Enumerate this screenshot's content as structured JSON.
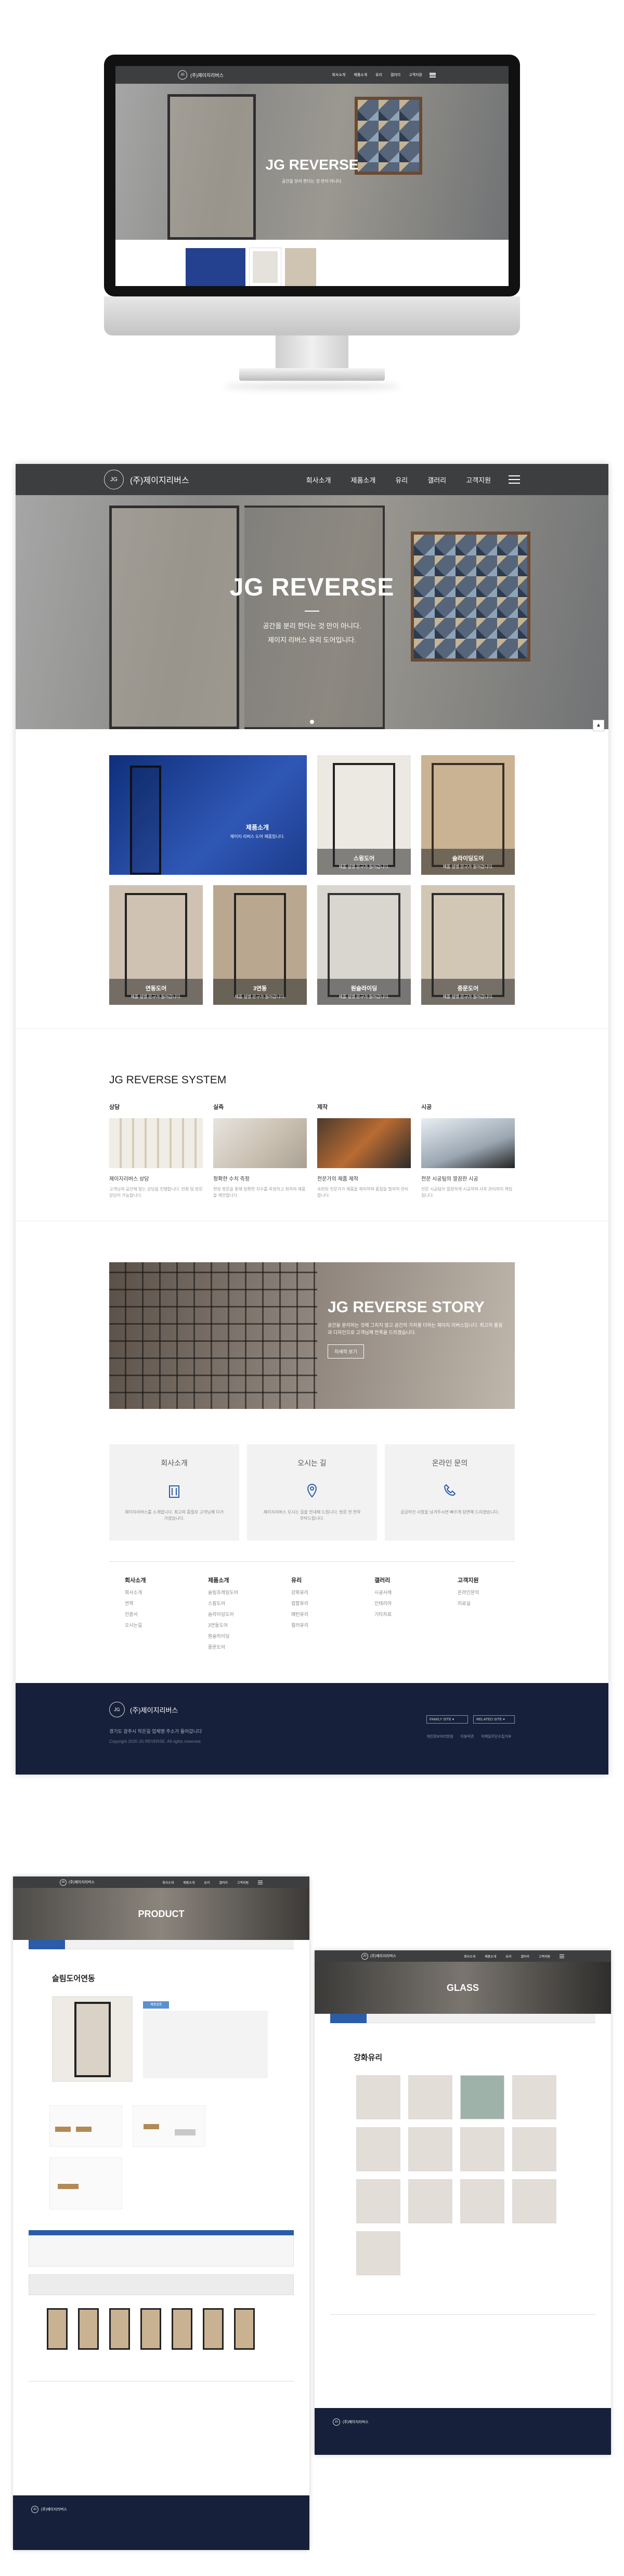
{
  "brand": {
    "name": "(주)제이지리버스"
  },
  "nav": [
    "회사소개",
    "제품소개",
    "유리",
    "갤러리",
    "고객지원"
  ],
  "hero": {
    "title": "JG REVERSE",
    "line1": "공간을 분리 한다는 것 만이 아니다.",
    "line2": "제이지 리버스 유리 도어입니다."
  },
  "products": [
    {
      "title": "제품소개",
      "sub": "제이지 리버스 도어 제품입니다."
    },
    {
      "title": "스윙도어",
      "sub": "제품 설명 문구가 들어갑니다."
    },
    {
      "title": "슬라이딩도어",
      "sub": "제품 설명 문구가 들어갑니다."
    },
    {
      "title": "연동도어",
      "sub": "제품 설명 문구가 들어갑니다."
    },
    {
      "title": "3연동",
      "sub": "제품 설명 문구가 들어갑니다."
    },
    {
      "title": "원슬라이딩",
      "sub": "제품 설명 문구가 들어갑니다."
    },
    {
      "title": "중문도어",
      "sub": "제품 설명 문구가 들어갑니다."
    }
  ],
  "system": {
    "title": "JG REVERSE SYSTEM",
    "items": [
      {
        "label": "상담",
        "heading": "제이지리버스 상담",
        "text": "고객님의 공간에 맞는 상담을 진행합니다. 전화 및 방문 상담이 가능합니다."
      },
      {
        "label": "실측",
        "heading": "정확한 수치 측정",
        "text": "현장 방문을 통해 정확한 치수를 측정하고 최적의 제품을 제안합니다."
      },
      {
        "label": "제작",
        "heading": "전문가의 제품 제작",
        "text": "숙련된 전문가가 제품을 제작하며 품질을 철저히 관리합니다."
      },
      {
        "label": "시공",
        "heading": "전문 시공팀의 깔끔한 시공",
        "text": "전문 시공팀이 깔끔하게 시공하며 사후 관리까지 책임집니다."
      }
    ]
  },
  "story": {
    "title": "JG REVERSE STORY",
    "text": "공간을 분리하는 것에 그치지 않고 공간의 가치를 더하는 제이지 리버스입니다. 최고의 품질과 디자인으로 고객님께 만족을 드리겠습니다.",
    "button": "자세히 보기"
  },
  "cards": [
    {
      "title": "회사소개",
      "icon": "building-icon",
      "text": "제이지리버스를 소개합니다. 최고의 품질로 고객님께 다가가겠습니다."
    },
    {
      "title": "오시는 길",
      "icon": "map-pin-icon",
      "text": "제이지리버스 오시는 길을 안내해 드립니다. 방문 전 연락 부탁드립니다."
    },
    {
      "title": "온라인 문의",
      "icon": "phone-icon",
      "text": "궁금하신 사항을 남겨주시면 빠르게 답변해 드리겠습니다."
    }
  ],
  "footer_cols": [
    {
      "h": "회사소개",
      "items": [
        "회사소개",
        "연혁",
        "인증서",
        "오시는길"
      ]
    },
    {
      "h": "제품소개",
      "items": [
        "슬림프레임도어",
        "스윙도어",
        "슬라이딩도어",
        "3연동도어",
        "원슬라이딩",
        "중문도어"
      ]
    },
    {
      "h": "유리",
      "items": [
        "강화유리",
        "접합유리",
        "패턴유리",
        "컬러유리"
      ]
    },
    {
      "h": "갤러리",
      "items": [
        "시공사례",
        "인테리어",
        "기타자료"
      ]
    },
    {
      "h": "고객지원",
      "items": [
        "온라인문의",
        "자료실"
      ]
    }
  ],
  "company": {
    "address": "경기도 광주시 작은길 업체명 주소가 들어갑니다",
    "copyright": "Copyright 2020 JG REVERSE. All rights reserved.",
    "family": "FAMILY SITE",
    "related": "RELATED SITE",
    "links": [
      "개인정보처리방침",
      "이용약관",
      "이메일무단수집거부"
    ]
  },
  "product_page": {
    "banner": "PRODUCT",
    "title": "슬림도어연동",
    "tab": "제품설명"
  },
  "glass_page": {
    "banner": "GLASS",
    "title": "강화유리"
  },
  "colors": {
    "header": "#3d3e40",
    "footer": "#16203a",
    "accent": "#2b5ca8"
  }
}
